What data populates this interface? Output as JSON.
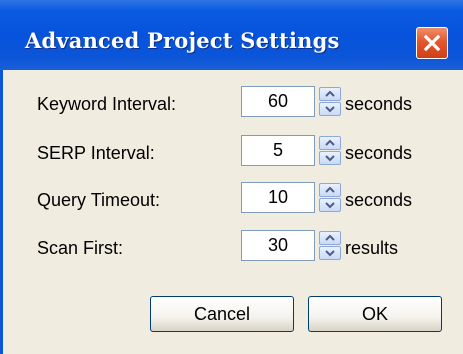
{
  "window": {
    "title": "Advanced Project Settings"
  },
  "settings": [
    {
      "label": "Keyword Interval:",
      "value": "60",
      "unit": "seconds"
    },
    {
      "label": "SERP Interval:",
      "value": "5",
      "unit": "seconds"
    },
    {
      "label": "Query Timeout:",
      "value": "10",
      "unit": "seconds"
    },
    {
      "label": "Scan First:",
      "value": "30",
      "unit": "results"
    }
  ],
  "buttons": {
    "cancel_label": "Cancel",
    "ok_label": "OK"
  },
  "icons": {
    "close": "close-icon",
    "spin_up": "chevron-up-icon",
    "spin_down": "chevron-down-icon"
  },
  "colors": {
    "titlebar": "#0753dc",
    "close_button": "#e2582e",
    "dialog_background": "#f0ede0"
  }
}
